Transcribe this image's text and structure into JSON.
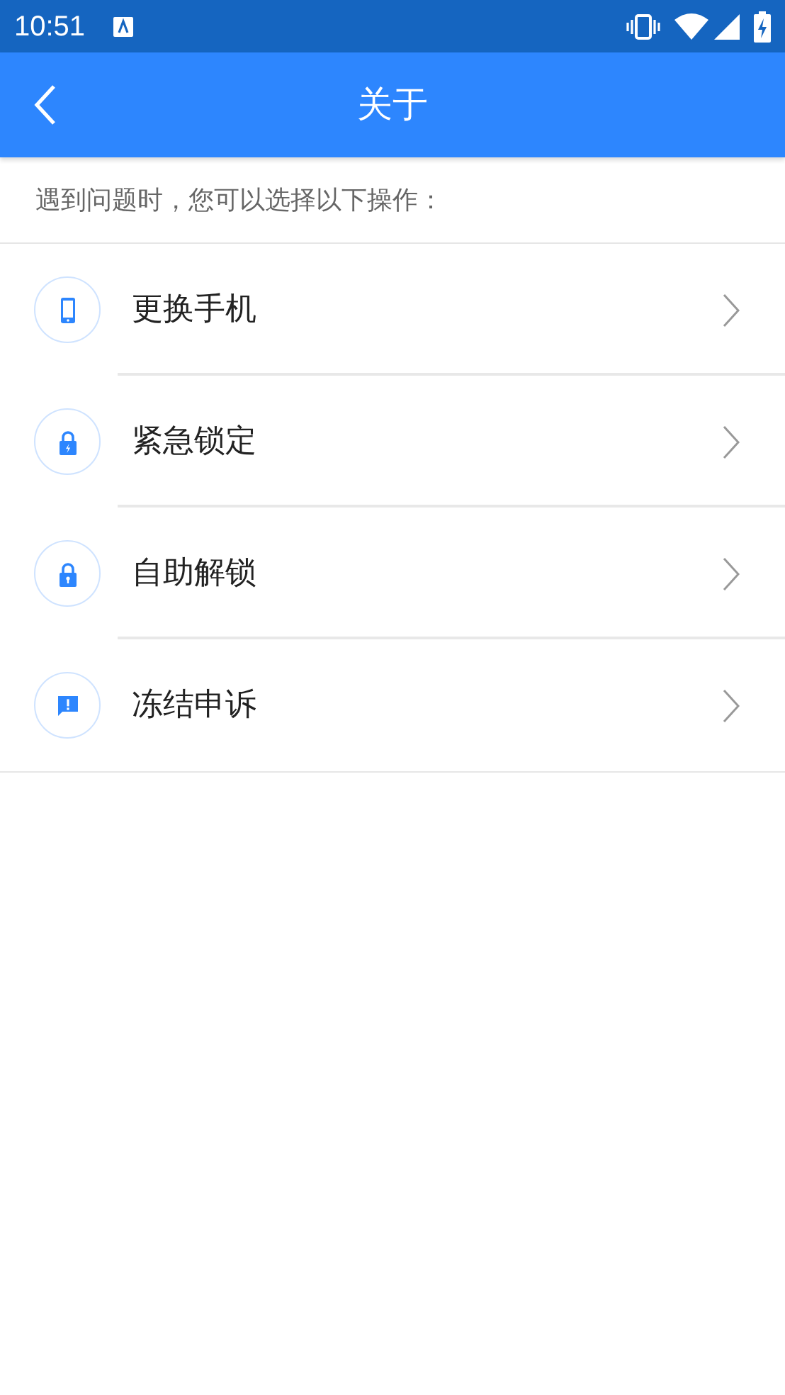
{
  "status_bar": {
    "time": "10:51"
  },
  "header": {
    "title": "关于"
  },
  "intro": "遇到问题时，您可以选择以下操作：",
  "items": [
    {
      "kind": "phone",
      "label": "更换手机"
    },
    {
      "kind": "lock-bolt",
      "label": "紧急锁定"
    },
    {
      "kind": "unlock",
      "label": "自助解锁"
    },
    {
      "kind": "alert",
      "label": "冻结申诉"
    }
  ]
}
